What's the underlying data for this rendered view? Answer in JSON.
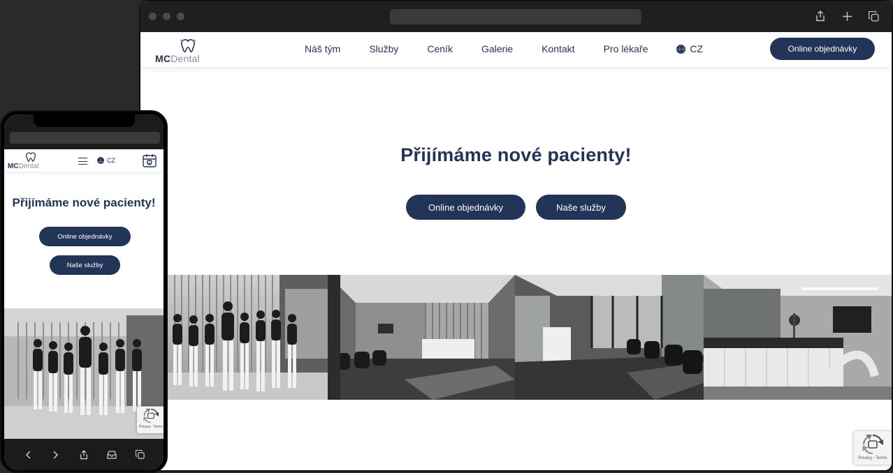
{
  "brand": {
    "name_bold": "MC",
    "name_light": "Dental",
    "accent": "#233459"
  },
  "desktop": {
    "nav": {
      "items": [
        {
          "label": "Náš tým"
        },
        {
          "label": "Služby"
        },
        {
          "label": "Ceník"
        },
        {
          "label": "Galerie"
        },
        {
          "label": "Kontakt"
        },
        {
          "label": "Pro lékaře"
        }
      ],
      "language": "CZ",
      "cta": "Online objednávky"
    },
    "hero": {
      "title": "Přijímáme nové pacienty!",
      "primary_button": "Online objednávky",
      "secondary_button": "Naše služby"
    },
    "gallery": {
      "photos": [
        {
          "name": "team-photo"
        },
        {
          "name": "reception-photo"
        },
        {
          "name": "waiting-room-photo"
        },
        {
          "name": "treatment-room-photo"
        }
      ]
    },
    "recaptcha": {
      "text": "Privacy - Terms"
    }
  },
  "mobile": {
    "language": "CZ",
    "hero": {
      "title": "Přijímáme nové pacienty!",
      "primary_button": "Online objednávky",
      "secondary_button": "Naše služby"
    },
    "recaptcha": {
      "text": "Privacy - Terms"
    }
  },
  "icons": [
    "share-icon",
    "plus-icon",
    "tabs-icon",
    "globe-icon",
    "menu-icon",
    "calendar-icon",
    "back-icon",
    "forward-icon",
    "bookmarks-icon",
    "recaptcha-icon"
  ]
}
